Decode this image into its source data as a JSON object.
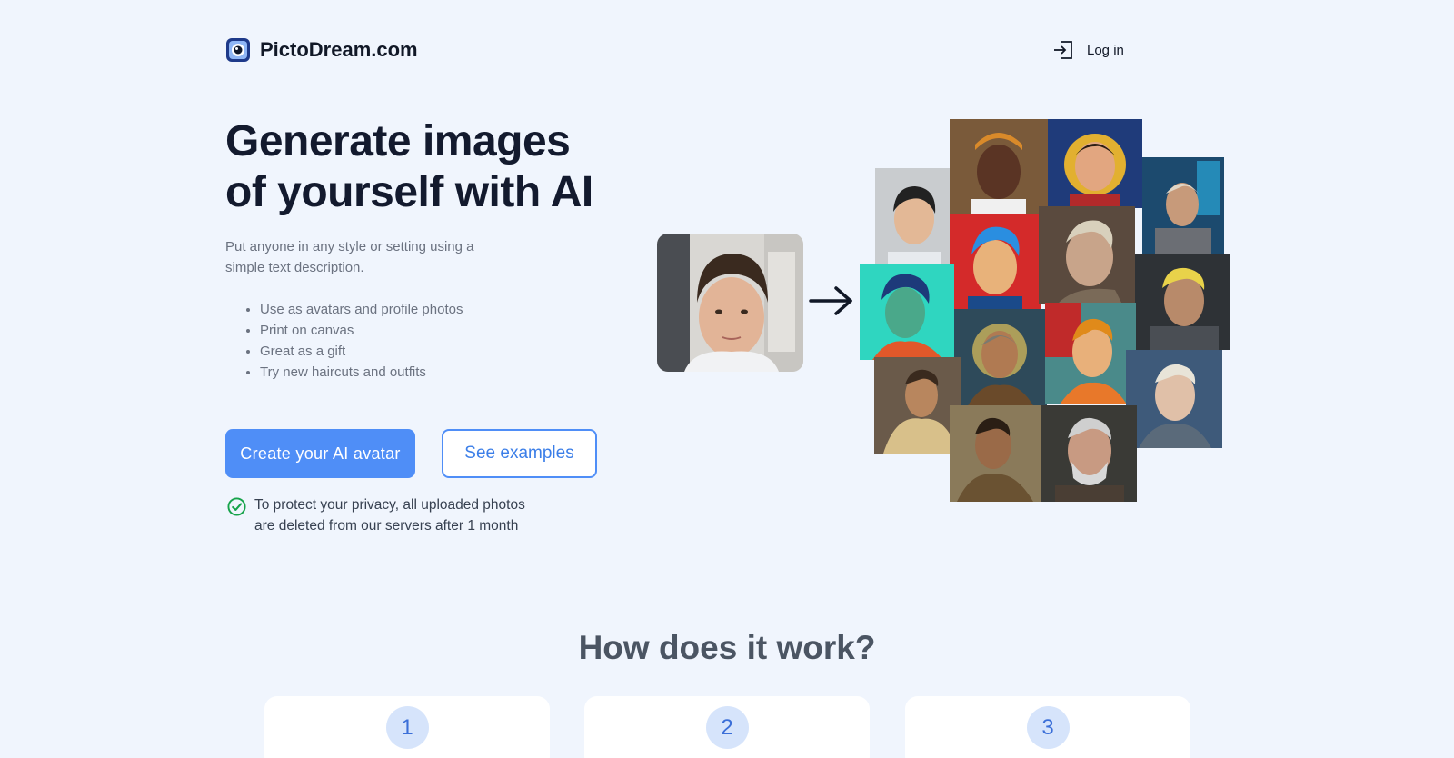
{
  "header": {
    "brand": "PictoDream.com",
    "login_label": "Log in"
  },
  "hero": {
    "title_line1": "Generate images",
    "title_line2": "of yourself with AI",
    "subtitle_line1": "Put anyone in any style or setting using a",
    "subtitle_line2": "simple text description.",
    "features": [
      "Use as avatars and profile photos",
      "Print on canvas",
      "Great as a gift",
      "Try new haircuts and outfits"
    ],
    "primary_button": "Create your AI avatar",
    "secondary_button": "See examples",
    "privacy_line1": "To protect your privacy, all uploaded photos",
    "privacy_line2": "are deleted from our servers after 1 month"
  },
  "how": {
    "title": "How does it work?",
    "steps": [
      "1",
      "2",
      "3"
    ]
  },
  "colors": {
    "background": "#f0f5fd",
    "accent": "#4f8ef7",
    "success": "#16a34a"
  },
  "icons": {
    "logo": "camera-lens-icon",
    "login": "login-icon",
    "arrow": "arrow-right-icon",
    "check": "check-circle-icon"
  }
}
